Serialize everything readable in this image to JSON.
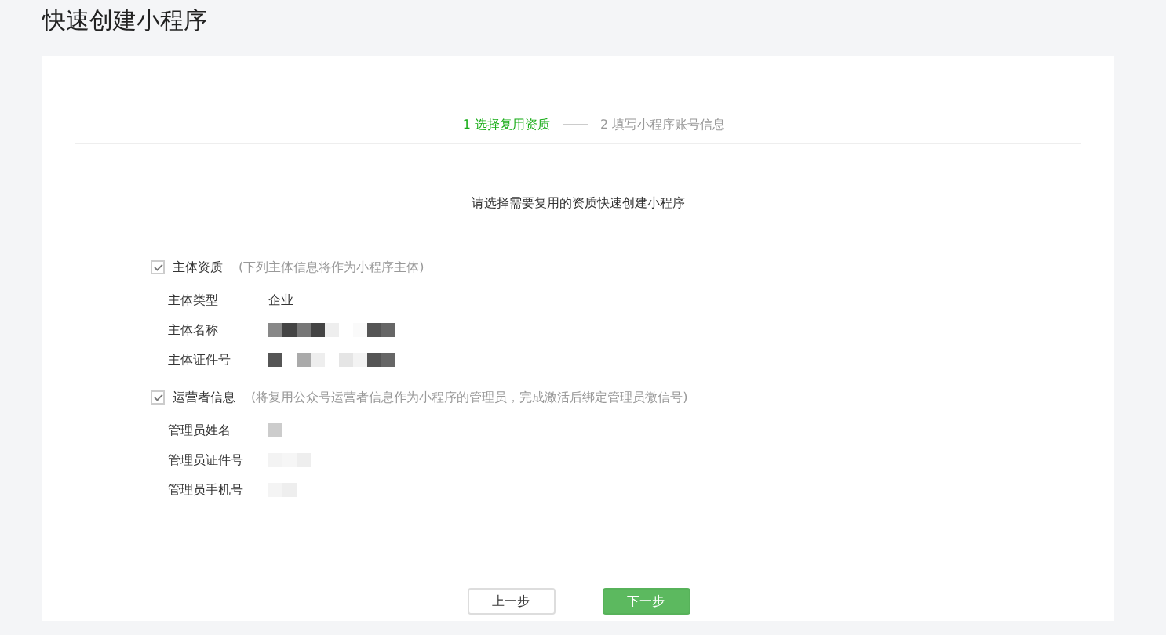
{
  "page": {
    "title": "快速创建小程序"
  },
  "steps": [
    {
      "label": "1 选择复用资质",
      "selected": true
    },
    {
      "label": "2 填写小程序账号信息",
      "selected": false
    }
  ],
  "instruction": "请选择需要复用的资质快速创建小程序",
  "sections": [
    {
      "label": "主体资质",
      "note": "(下列主体信息将作为小程序主体)",
      "checked": true,
      "fields": [
        {
          "label": "主体类型",
          "value": "企业"
        },
        {
          "label": "主体名称",
          "redacted": true
        },
        {
          "label": "主体证件号",
          "redacted": true
        }
      ]
    },
    {
      "label": "运营者信息",
      "note": "(将复用公众号运营者信息作为小程序的管理员，完成激活后绑定管理员微信号)",
      "checked": true,
      "fields": [
        {
          "label": "管理员姓名",
          "redacted": true
        },
        {
          "label": "管理员证件号",
          "redacted": true
        },
        {
          "label": "管理员手机号",
          "redacted": true
        }
      ]
    }
  ],
  "buttons": [
    {
      "label": "上一步",
      "kind": "secondary"
    },
    {
      "label": "下一步",
      "kind": "primary"
    }
  ]
}
